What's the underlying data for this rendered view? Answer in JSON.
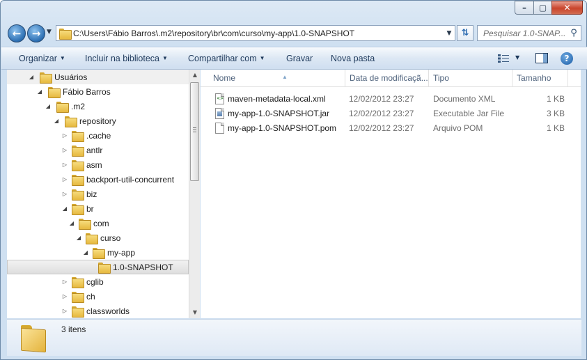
{
  "window": {
    "caption": {
      "minimize": "–",
      "maximize": "▢",
      "close": "✕"
    }
  },
  "address": {
    "path": "C:\\Users\\Fábio Barros\\.m2\\repository\\br\\com\\curso\\my-app\\1.0-SNAPSHOT"
  },
  "search": {
    "placeholder": "Pesquisar 1.0-SNAP..."
  },
  "toolbar": {
    "organize": "Organizar",
    "include_library": "Incluir na biblioteca",
    "share": "Compartilhar com",
    "burn": "Gravar",
    "new_folder": "Nova pasta"
  },
  "tree": {
    "items": [
      {
        "label": "Usuários",
        "expanded": true
      },
      {
        "label": "Fábio Barros",
        "expanded": true,
        "locked": true
      },
      {
        "label": ".m2",
        "expanded": true
      },
      {
        "label": "repository",
        "expanded": true
      },
      {
        "label": ".cache",
        "expanded": false
      },
      {
        "label": "antlr",
        "expanded": false
      },
      {
        "label": "asm",
        "expanded": false
      },
      {
        "label": "backport-util-concurrent",
        "expanded": false
      },
      {
        "label": "biz",
        "expanded": false
      },
      {
        "label": "br",
        "expanded": true
      },
      {
        "label": "com",
        "expanded": true
      },
      {
        "label": "curso",
        "expanded": true
      },
      {
        "label": "my-app",
        "expanded": true
      },
      {
        "label": "1.0-SNAPSHOT",
        "expanded": null,
        "selected": true
      },
      {
        "label": "cglib",
        "expanded": false
      },
      {
        "label": "ch",
        "expanded": false
      },
      {
        "label": "classworlds",
        "expanded": false
      }
    ]
  },
  "list": {
    "columns": {
      "name": "Nome",
      "date": "Data de modificaçã...",
      "type": "Tipo",
      "size": "Tamanho"
    },
    "files": [
      {
        "name": "maven-metadata-local.xml",
        "date": "12/02/2012 23:27",
        "type": "Documento XML",
        "size": "1 KB",
        "icon": "xml-file-icon"
      },
      {
        "name": "my-app-1.0-SNAPSHOT.jar",
        "date": "12/02/2012 23:27",
        "type": "Executable Jar File",
        "size": "3 KB",
        "icon": "jar-file-icon"
      },
      {
        "name": "my-app-1.0-SNAPSHOT.pom",
        "date": "12/02/2012 23:27",
        "type": "Arquivo POM",
        "size": "1 KB",
        "icon": "pom-file-icon"
      }
    ]
  },
  "status": {
    "item_count": "3 itens"
  }
}
